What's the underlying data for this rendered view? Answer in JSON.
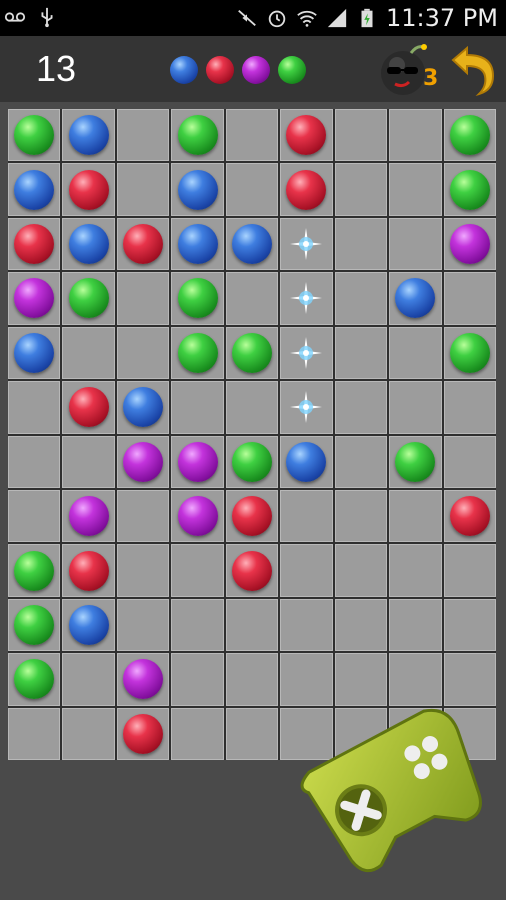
{
  "statusbar": {
    "time": "11:37 PM"
  },
  "score": "13",
  "preview": [
    "blue",
    "red",
    "purple",
    "green"
  ],
  "bomb": {
    "count": "3"
  },
  "colors": {
    "green": "#2fbf35",
    "blue": "#2a5fcf",
    "red": "#d4233a",
    "purple": "#b02ac8",
    "cell": "#9c9c9c",
    "bomb_count": "#f0a000"
  },
  "board": [
    [
      "green",
      "blue",
      "",
      "green",
      "",
      "red",
      "",
      "",
      "green"
    ],
    [
      "blue",
      "red",
      "",
      "blue",
      "",
      "red",
      "",
      "",
      "green"
    ],
    [
      "red",
      "blue",
      "red",
      "blue",
      "blue",
      "spark",
      "",
      "",
      "purple"
    ],
    [
      "purple",
      "green",
      "",
      "green",
      "",
      "spark",
      "",
      "blue",
      ""
    ],
    [
      "blue",
      "",
      "",
      "green",
      "green",
      "spark",
      "",
      "",
      "green"
    ],
    [
      "",
      "red",
      "blue",
      "",
      "",
      "spark",
      "",
      "",
      ""
    ],
    [
      "",
      "",
      "purple",
      "purple",
      "green",
      "blue",
      "",
      "green",
      ""
    ],
    [
      "",
      "purple",
      "",
      "purple",
      "red",
      "",
      "",
      "",
      "red"
    ],
    [
      "green",
      "red",
      "",
      "",
      "red",
      "",
      "",
      "",
      ""
    ],
    [
      "green",
      "blue",
      "",
      "",
      "",
      "",
      "",
      "",
      ""
    ],
    [
      "green",
      "",
      "purple",
      "",
      "",
      "",
      "",
      "",
      ""
    ],
    [
      "",
      "",
      "red",
      "",
      "",
      "",
      "",
      "",
      ""
    ]
  ]
}
